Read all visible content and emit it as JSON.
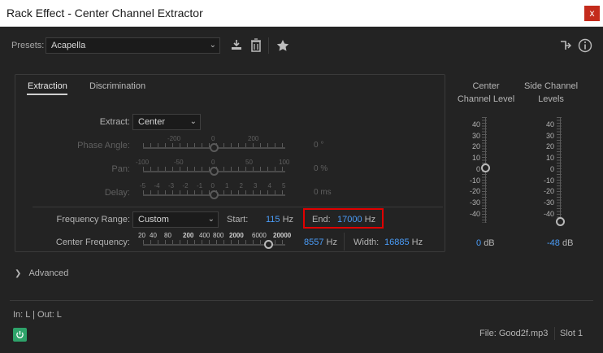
{
  "window": {
    "title": "Rack Effect - Center Channel Extractor",
    "close": "x"
  },
  "presets": {
    "label": "Presets:",
    "value": "Acapella"
  },
  "tabs": [
    "Extraction",
    "Discrimination"
  ],
  "extraction": {
    "extract_label": "Extract:",
    "extract_value": "Center",
    "phase_angle": {
      "label": "Phase Angle:",
      "scale": [
        "-200",
        "0",
        "200"
      ],
      "value": "0",
      "unit": "°"
    },
    "pan": {
      "label": "Pan:",
      "scale": [
        "-100",
        "-50",
        "0",
        "50",
        "100"
      ],
      "value": "0",
      "unit": "%"
    },
    "delay": {
      "label": "Delay:",
      "scale": [
        "-5",
        "-4",
        "-3",
        "-2",
        "-1",
        "0",
        "1",
        "2",
        "3",
        "4",
        "5"
      ],
      "value": "0",
      "unit": "ms"
    }
  },
  "frequency": {
    "range_label": "Frequency Range:",
    "range_value": "Custom",
    "start_label": "Start:",
    "start_value": "115",
    "end_label": "End:",
    "end_value": "17000",
    "hz": "Hz",
    "center_label": "Center Frequency:",
    "center_scale": [
      "20",
      "40",
      "80",
      "200",
      "400",
      "800",
      "2000",
      "6000",
      "20000"
    ],
    "center_value": "8557",
    "width_label": "Width:",
    "width_value": "16885",
    "center_slider_fraction": 0.88
  },
  "meters": {
    "center_title": [
      "Center",
      "Channel Level"
    ],
    "side_title": [
      "Side Channel",
      "Levels"
    ],
    "scale": [
      "40",
      "30",
      "20",
      "10",
      "0",
      "-10",
      "-20",
      "-30",
      "-40"
    ],
    "center_value": "0",
    "side_value": "-48",
    "unit": "dB"
  },
  "advanced_label": "Advanced",
  "footer": {
    "io": "In: L | Out: L",
    "file": "File: Good2f.mp3",
    "slot": "Slot 1"
  },
  "icons": [
    "download-icon",
    "trash-icon",
    "star-icon",
    "routing-icon",
    "info-icon",
    "chevron-right-icon",
    "power-icon"
  ]
}
